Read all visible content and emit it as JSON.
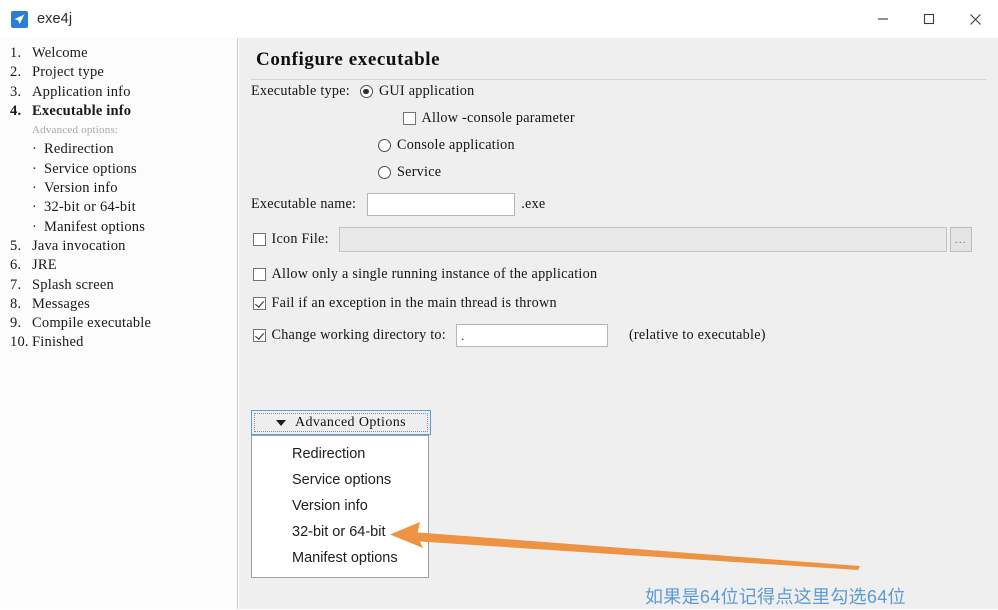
{
  "window": {
    "app_title": "exe4j",
    "app_icon": "exe4j-arrow-icon",
    "controls": {
      "minimize": "minimize-icon",
      "maximize": "maximize-icon",
      "close": "close-icon"
    }
  },
  "sidebar": {
    "items": [
      {
        "num": "1.",
        "label": "Welcome",
        "active": false
      },
      {
        "num": "2.",
        "label": "Project type",
        "active": false
      },
      {
        "num": "3.",
        "label": "Application info",
        "active": false
      },
      {
        "num": "4.",
        "label": "Executable info",
        "active": true
      }
    ],
    "sub_header": "Advanced options:",
    "sub_items": [
      {
        "label": "Redirection"
      },
      {
        "label": "Service options"
      },
      {
        "label": "Version info"
      },
      {
        "label": "32-bit or 64-bit"
      },
      {
        "label": "Manifest options"
      }
    ],
    "items_after": [
      {
        "num": "5.",
        "label": "Java invocation",
        "active": false
      },
      {
        "num": "6.",
        "label": "JRE",
        "active": false
      },
      {
        "num": "7.",
        "label": "Splash screen",
        "active": false
      },
      {
        "num": "8.",
        "label": "Messages",
        "active": false
      },
      {
        "num": "9.",
        "label": "Compile executable",
        "active": false
      },
      {
        "num": "10.",
        "label": "Finished",
        "active": false
      }
    ]
  },
  "main": {
    "title": "Configure executable",
    "executable_type": {
      "label": "Executable type:",
      "options": [
        {
          "label": "GUI application",
          "checked": true
        },
        {
          "label": "Console application",
          "checked": false
        },
        {
          "label": "Service",
          "checked": false
        }
      ],
      "allow_console": {
        "label": "Allow -console parameter",
        "checked": false
      }
    },
    "executable_name": {
      "label": "Executable name:",
      "value": "",
      "suffix": ".exe"
    },
    "icon_file": {
      "label": "Icon File:",
      "checked": false,
      "value": "",
      "browse_label": "..."
    },
    "single_instance": {
      "label": "Allow only a single running instance of the application",
      "checked": false
    },
    "fail_on_exception": {
      "label": "Fail if an exception in the main thread is thrown",
      "checked": true
    },
    "working_directory": {
      "label": "Change working directory to:",
      "checked": true,
      "value": ".",
      "hint": "(relative to executable)"
    },
    "advanced_options_button": {
      "label": "Advanced Options",
      "caret": "chevron-down-icon"
    },
    "advanced_menu": [
      {
        "label": "Redirection"
      },
      {
        "label": "Service options"
      },
      {
        "label": "Version info"
      },
      {
        "label": "32-bit or 64-bit"
      },
      {
        "label": "Manifest options"
      }
    ]
  },
  "annotation": {
    "text": "如果是64位记得点这里勾选64位",
    "color": "#5b9bd5",
    "arrow_color": "#ed9343"
  }
}
